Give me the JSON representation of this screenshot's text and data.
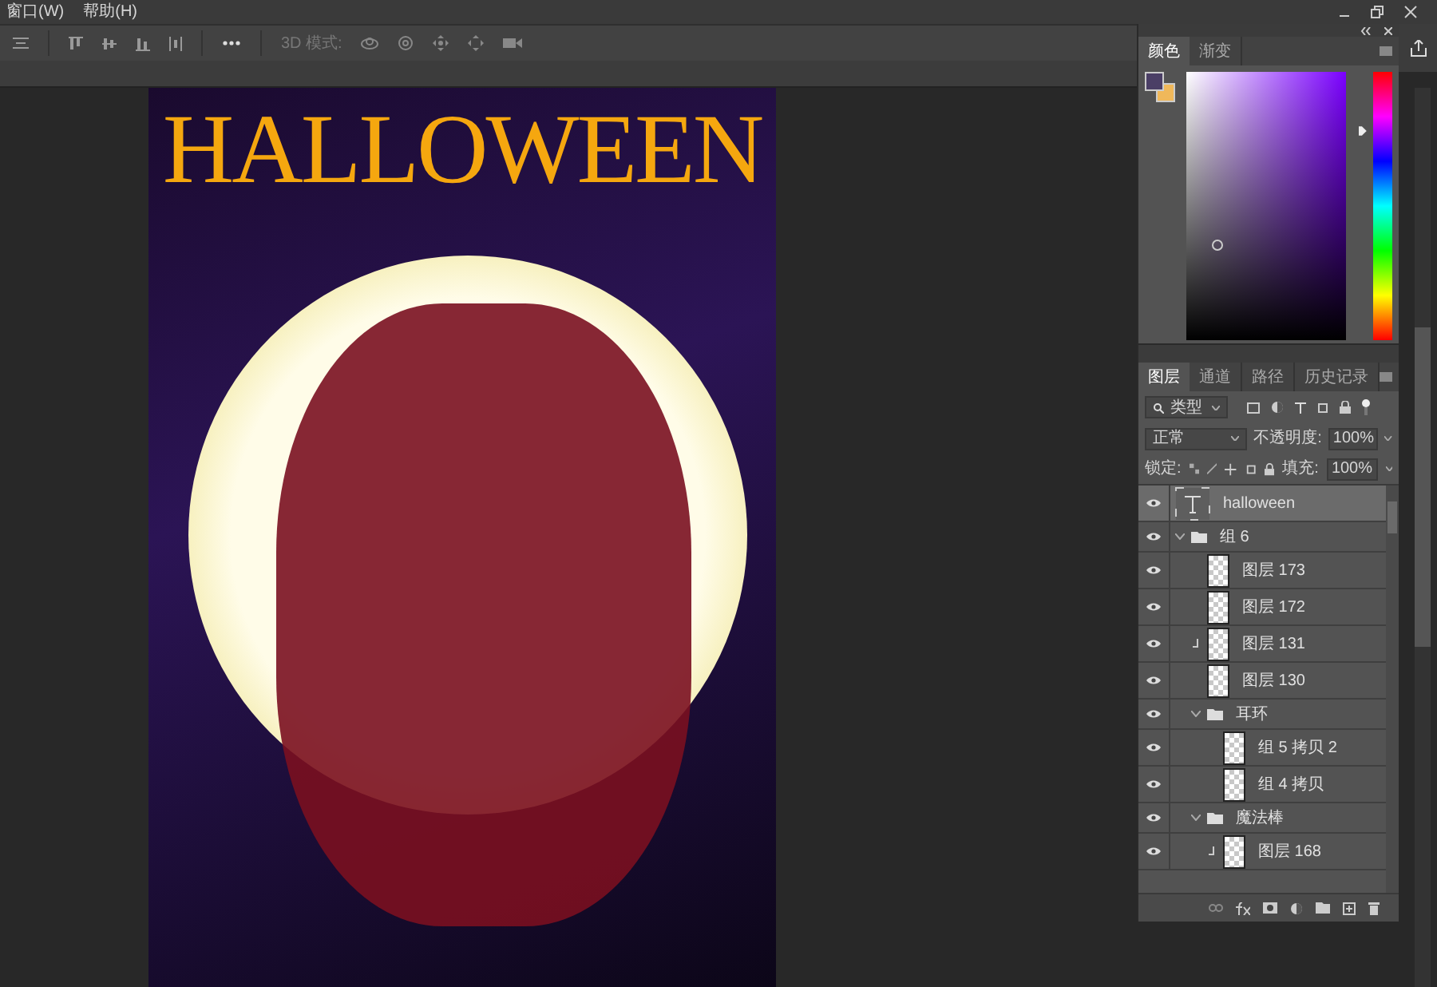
{
  "menu": [
    "窗口(W)",
    "帮助(H)"
  ],
  "options_bar": {
    "mode_label": "3D 模式:"
  },
  "canvas": {
    "title": "HALLOWEEN"
  },
  "color_panel": {
    "tabs": [
      {
        "label": "颜色",
        "selected": true
      },
      {
        "label": "渐变",
        "selected": false
      }
    ]
  },
  "layers_panel": {
    "tabs": [
      {
        "label": "图层",
        "selected": true
      },
      {
        "label": "通道",
        "selected": false
      },
      {
        "label": "路径",
        "selected": false
      },
      {
        "label": "历史记录",
        "selected": false
      }
    ],
    "filter": "类型",
    "blend_mode": "正常",
    "opacity_label": "不透明度:",
    "opacity": "100%",
    "lock_label": "锁定:",
    "fill_label": "填充:",
    "fill": "100%",
    "layers": [
      {
        "kind": "text",
        "name": "halloween",
        "visible": true,
        "selected": true
      },
      {
        "kind": "group",
        "name": "组 6",
        "visible": true,
        "selected": false,
        "expanded": true,
        "children": [
          {
            "kind": "layer",
            "name": "图层 173",
            "visible": true,
            "selected": false,
            "clipped": false
          },
          {
            "kind": "layer",
            "name": "图层 172",
            "visible": true,
            "selected": false,
            "clipped": false
          },
          {
            "kind": "layer",
            "name": "图层 131",
            "visible": true,
            "selected": false,
            "clipped": true
          },
          {
            "kind": "layer",
            "name": "图层 130",
            "visible": true,
            "selected": false,
            "clipped": false
          },
          {
            "kind": "group",
            "name": "耳环",
            "visible": true,
            "selected": false,
            "expanded": true,
            "children": [
              {
                "kind": "layer",
                "name": "组 5 拷贝 2",
                "visible": true,
                "selected": false,
                "clipped": false
              },
              {
                "kind": "layer",
                "name": "组 4 拷贝",
                "visible": true,
                "selected": false,
                "clipped": false
              }
            ]
          },
          {
            "kind": "group",
            "name": "魔法棒",
            "visible": true,
            "selected": false,
            "expanded": true,
            "children": [
              {
                "kind": "layer",
                "name": "图层 168",
                "visible": true,
                "selected": false,
                "clipped": true
              }
            ]
          }
        ]
      }
    ]
  }
}
